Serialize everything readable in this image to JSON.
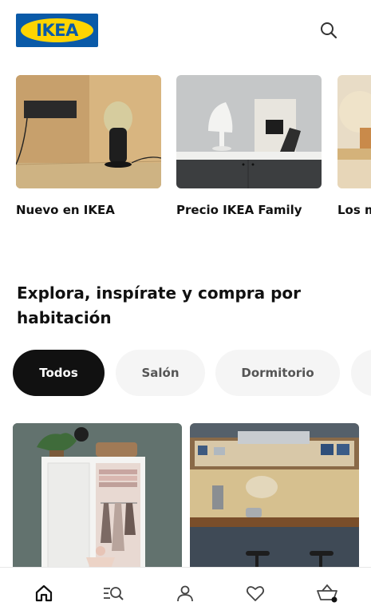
{
  "brand": {
    "logo_text": "IKEA",
    "blue": "#0a5aa8",
    "yellow": "#ffd400"
  },
  "header": {
    "search_icon": "search-icon"
  },
  "featured": [
    {
      "label": "Nuevo en IKEA"
    },
    {
      "label": "Precio IKEA Family"
    },
    {
      "label": "Los m"
    }
  ],
  "section": {
    "title": "Explora, inspírate y compra por habitación"
  },
  "chips": [
    {
      "label": "Todos",
      "active": true
    },
    {
      "label": "Salón",
      "active": false
    },
    {
      "label": "Dormitorio",
      "active": false
    }
  ],
  "bottom_nav": [
    {
      "icon": "home-icon",
      "active": true
    },
    {
      "icon": "search-list-icon",
      "active": false
    },
    {
      "icon": "profile-icon",
      "active": false
    },
    {
      "icon": "heart-icon",
      "active": false
    },
    {
      "icon": "basket-icon",
      "active": false
    }
  ]
}
